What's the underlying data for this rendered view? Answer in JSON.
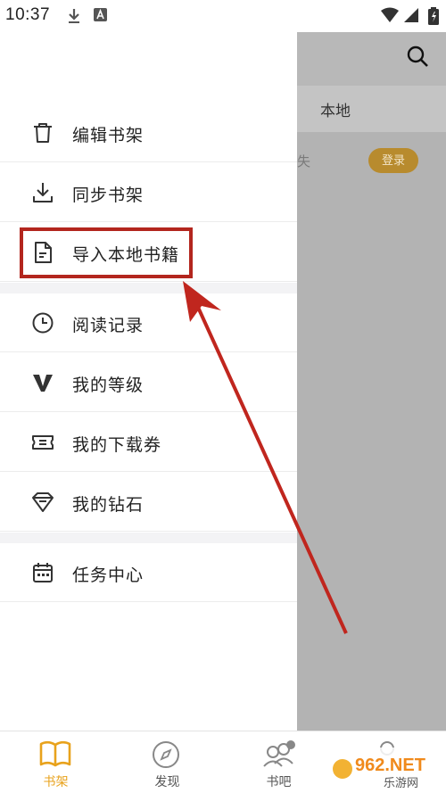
{
  "status_bar": {
    "time": "10:37"
  },
  "background_app": {
    "tab_label": "本地",
    "row_fragment": "失",
    "login_label": "登录"
  },
  "drawer": {
    "group1": [
      {
        "label": "编辑书架",
        "icon": "trash-icon"
      },
      {
        "label": "同步书架",
        "icon": "download-icon"
      },
      {
        "label": "导入本地书籍",
        "icon": "document-icon"
      }
    ],
    "group2": [
      {
        "label": "阅读记录",
        "icon": "clock-icon"
      },
      {
        "label": "我的等级",
        "icon": "level-v-icon"
      },
      {
        "label": "我的下载券",
        "icon": "ticket-icon"
      },
      {
        "label": "我的钻石",
        "icon": "diamond-icon"
      }
    ],
    "group3": [
      {
        "label": "任务中心",
        "icon": "calendar-icon"
      }
    ]
  },
  "bottom_nav": [
    {
      "label": "书架",
      "icon": "book-icon",
      "active": true
    },
    {
      "label": "发现",
      "icon": "compass-icon",
      "active": false
    },
    {
      "label": "书吧",
      "icon": "community-icon",
      "active": false
    },
    {
      "label": "",
      "icon": "profile-icon",
      "active": false
    }
  ],
  "watermark": {
    "text_top": "962.NET",
    "text_bottom": "乐游网"
  },
  "colors": {
    "accent": "#e8a21c",
    "highlight": "#b3261e",
    "overlay": "#b3b3b3"
  }
}
